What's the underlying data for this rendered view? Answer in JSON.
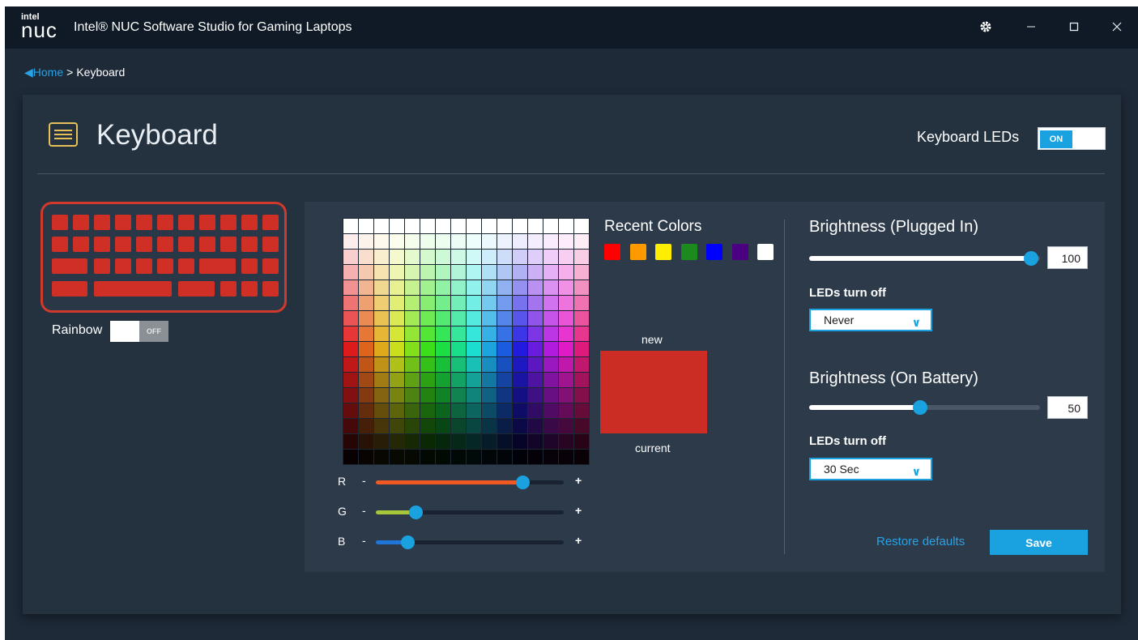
{
  "titlebar": {
    "logo_top": "intel",
    "logo_bottom": "nuc",
    "title": "Intel® NUC Software Studio for Gaming Laptops",
    "settings_icon": "gear-icon",
    "minimize_icon": "minimize-icon",
    "maximize_icon": "maximize-icon",
    "close_icon": "close-icon"
  },
  "breadcrumb": {
    "home": "Home",
    "separator": ">",
    "current": "Keyboard"
  },
  "page": {
    "title": "Keyboard",
    "icon": "keyboard-icon",
    "leds_label": "Keyboard LEDs",
    "leds_state": "ON"
  },
  "keyboard_preview": {
    "key_color": "#cf2f24",
    "border_color": "#d03a2c"
  },
  "rainbow": {
    "label": "Rainbow",
    "state": "OFF"
  },
  "rgb": {
    "r": {
      "label": "R",
      "minus": "-",
      "plus": "+",
      "value": 0.78,
      "color": "#f05a22"
    },
    "g": {
      "label": "G",
      "minus": "-",
      "plus": "+",
      "value": 0.21,
      "color": "#a4c83a"
    },
    "b": {
      "label": "B",
      "minus": "-",
      "plus": "+",
      "value": 0.17,
      "color": "#1f75d8"
    }
  },
  "recent_colors": {
    "label": "Recent Colors",
    "colors": [
      "#ff0000",
      "#ff9900",
      "#ffee00",
      "#1d8a1d",
      "#0000ff",
      "#4b0082",
      "#ffffff"
    ]
  },
  "swatch": {
    "new_label": "new",
    "current_label": "current",
    "color": "#cb2d24"
  },
  "brightness_plugged": {
    "title": "Brightness (Plugged In)",
    "value": "100",
    "fraction": 1.0,
    "leds_off_label": "LEDs turn off",
    "leds_off_value": "Never"
  },
  "brightness_battery": {
    "title": "Brightness (On Battery)",
    "value": "50",
    "fraction": 0.5,
    "leds_off_label": "LEDs turn off",
    "leds_off_value": "30 Sec"
  },
  "actions": {
    "restore": "Restore defaults",
    "save": "Save"
  },
  "accent": "#1aa2e0"
}
